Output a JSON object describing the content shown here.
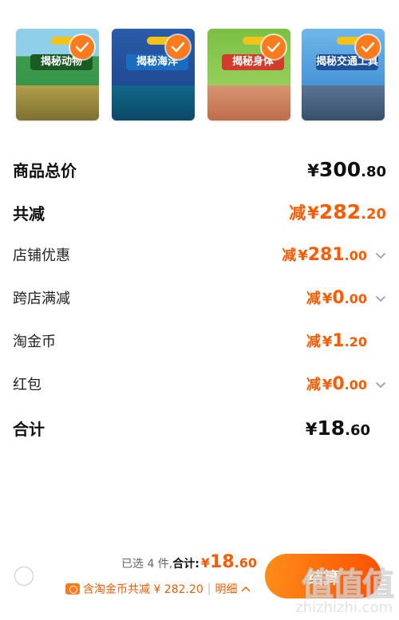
{
  "products": [
    {
      "title": "揭秘动物",
      "cover_color": "#2e8f46",
      "title_color": "#1c5a24",
      "ground_color": "#c9a04b",
      "selected": true
    },
    {
      "title": "揭秘海洋",
      "cover_color": "#1b3f86",
      "title_color": "#1a6cc0",
      "ground_color": "#0e6d88",
      "selected": true
    },
    {
      "title": "揭秘身体",
      "cover_color": "#7bc043",
      "title_color": "#d33b2c",
      "ground_color": "#e48b76",
      "selected": true
    },
    {
      "title": "揭秘交通工具",
      "cover_color": "#2f7fc9",
      "title_color": "#1d4f9b",
      "ground_color": "#5d6f86",
      "selected": true
    }
  ],
  "price_rows": {
    "total": {
      "label": "商品总价",
      "yen": "¥",
      "int": "300",
      "dec": ".80"
    },
    "discount": {
      "label": "共减",
      "minus": "减",
      "yen": "¥",
      "int": "282",
      "dec": ".20"
    },
    "shop": {
      "label": "店铺优惠",
      "minus": "减",
      "yen": "¥",
      "int": "281",
      "dec": ".00",
      "chevron": "chevron-down-icon"
    },
    "cross": {
      "label": "跨店满减",
      "minus": "减",
      "yen": "¥",
      "int": "0",
      "dec": ".00",
      "chevron": "chevron-down-icon"
    },
    "coin": {
      "label": "淘金币",
      "minus": "减",
      "yen": "¥",
      "int": "1",
      "dec": ".20"
    },
    "redpacket": {
      "label": "红包",
      "minus": "减",
      "yen": "¥",
      "int": "0",
      "dec": ".00",
      "chevron": "chevron-down-icon"
    },
    "sum": {
      "label": "合计",
      "yen": "¥",
      "int": "18",
      "dec": ".60"
    }
  },
  "bottom_bar": {
    "selected_text": "已选 4 件,",
    "sum_label": "合计:",
    "sum_yen": "¥",
    "sum_int": "18",
    "sum_dec": ".60",
    "coin_text": "含淘金币共减 ¥ 282.20",
    "detail_label": "明细",
    "checkout_label": "结算"
  },
  "watermark": {
    "text": "值值值",
    "url": "zhizhizhi.com"
  },
  "colors": {
    "accent": "#ff5a00",
    "check": "#ff7a1a"
  }
}
